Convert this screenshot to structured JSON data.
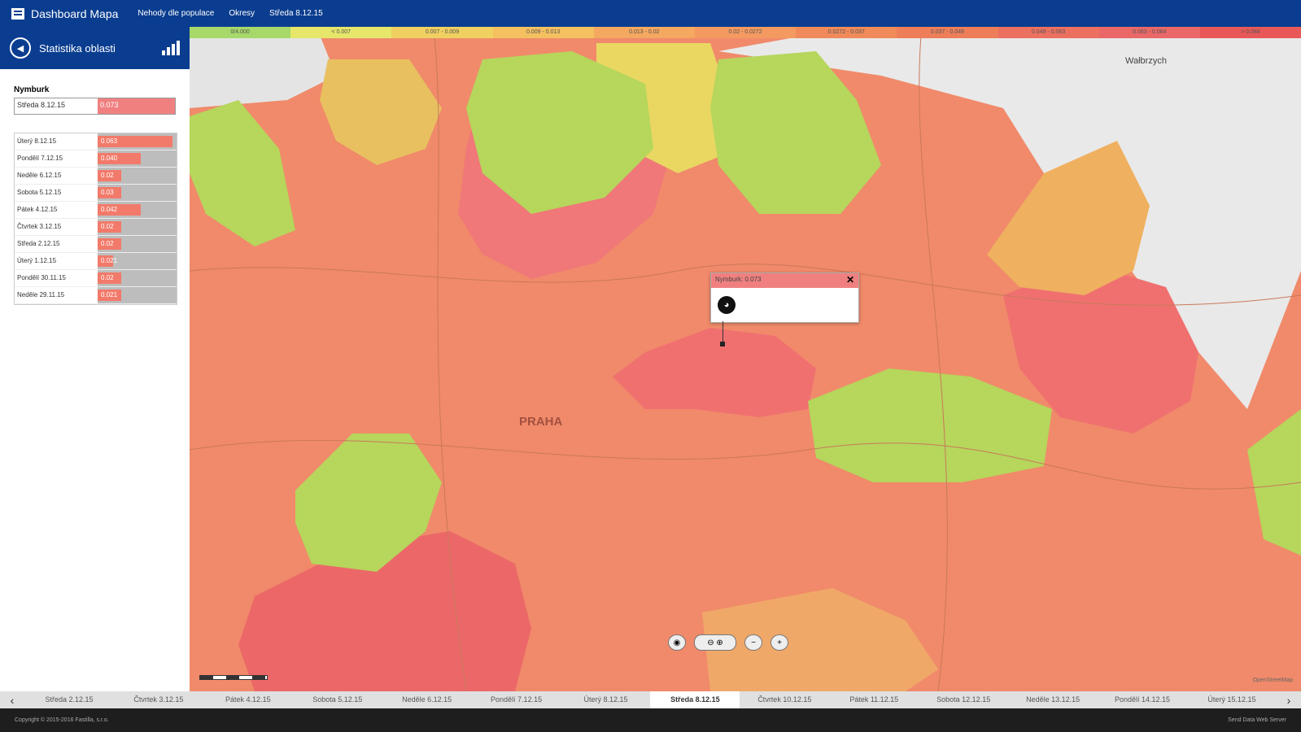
{
  "app": {
    "title": "Dashboard Mapa",
    "nav": [
      "Nehody dle populace",
      "Okresy",
      "Středa 8.12.15"
    ]
  },
  "sidebar": {
    "title": "Statistika oblasti",
    "region": "Nymburk",
    "selected": {
      "date": "Středa 8.12.15",
      "value": "0.073"
    },
    "rows": [
      {
        "date": "Úterý 8.12.15",
        "value": "0.063",
        "level": 0.95
      },
      {
        "date": "Pondělí 7.12.15",
        "value": "0.040",
        "level": 0.55
      },
      {
        "date": "Neděle 6.12.15",
        "value": "0.02",
        "level": 0.3
      },
      {
        "date": "Sobota 5.12.15",
        "value": "0.03",
        "level": 0.3
      },
      {
        "date": "Pátek 4.12.15",
        "value": "0.042",
        "level": 0.55
      },
      {
        "date": "Čtvrtek 3.12.15",
        "value": "0.02",
        "level": 0.3
      },
      {
        "date": "Středa 2.12.15",
        "value": "0.02",
        "level": 0.3
      },
      {
        "date": "Úterý 1.12.15",
        "value": "0.021",
        "level": 0.2
      },
      {
        "date": "Pondělí 30.11.15",
        "value": "0.02",
        "level": 0.3
      },
      {
        "date": "Neděle 29.11.15",
        "value": "0.021",
        "level": 0.3
      }
    ]
  },
  "map": {
    "legend": [
      "0/4.000",
      "< 0.007",
      "0.007 - 0.009",
      "0.009 - 0.013",
      "0.013 - 0.02",
      "0.02 - 0.0272",
      "0.0272 - 0.037",
      "0.037 - 0.049",
      "0.049 - 0.063",
      "0.063 - 0.084",
      "> 0.084"
    ],
    "legend_colors": [
      "#a6d96a",
      "#e6e66a",
      "#f0d060",
      "#f4c060",
      "#f4a860",
      "#f49a60",
      "#f08a5a",
      "#ee7e5a",
      "#ec7060",
      "#ea6868",
      "#e85858"
    ],
    "labels": {
      "city": "PRAHA",
      "top_right_city": "Wałbrzych"
    },
    "popup": {
      "title": "Nymburk: 0.073"
    },
    "attribution": "OpenStreetMap"
  },
  "timeline": {
    "items": [
      "Středa 2.12.15",
      "Čtvrtek 3.12.15",
      "Pátek 4.12.15",
      "Sobota 5.12.15",
      "Neděle 6.12.15",
      "Pondělí 7.12.15",
      "Úterý 8.12.15",
      "Středa 8.12.15",
      "Čtvrtek 10.12.15",
      "Pátek 11.12.15",
      "Sobota 12.12.15",
      "Neděle 13.12.15",
      "Pondělí 14.12.15",
      "Úterý 15.12.15"
    ],
    "active_index": 7
  },
  "footer": {
    "copyright": "Copyright © 2015-2016 Fastilla, s.r.o.",
    "right": "Send Data Web Server"
  }
}
